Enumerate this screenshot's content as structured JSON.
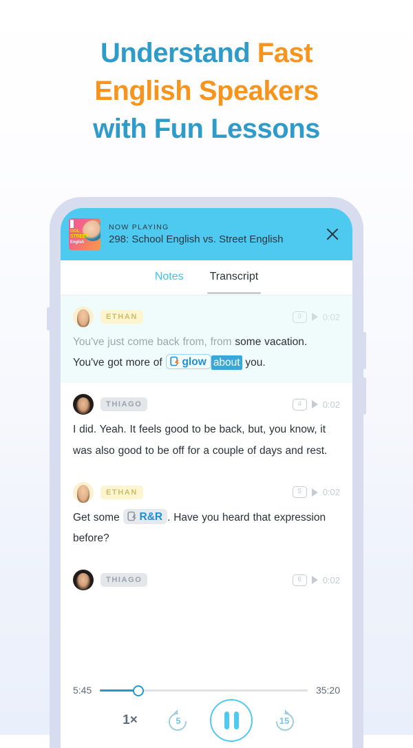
{
  "headline": {
    "line1_a": "Understand ",
    "line1_b": "Fast",
    "line2": "English Speakers",
    "line3": "with Fun Lessons",
    "color_blue": "#2e9bc9",
    "color_orange": "#f7941e"
  },
  "player_header": {
    "now_playing_label": "NOW PLAYING",
    "episode_title": "298: School English vs. Street English",
    "close_icon": "close-icon",
    "album_art": {
      "text_line1": "OOL",
      "text_line2": "STREET",
      "text_line3": "English"
    },
    "bg_color": "#4ec9f0"
  },
  "tabs": [
    {
      "label": "Notes",
      "selected_color": true,
      "underlined": false
    },
    {
      "label": "Transcript",
      "selected_color": false,
      "underlined": true
    }
  ],
  "transcript": {
    "messages": [
      {
        "speaker": "ETHAN",
        "speaker_style": "ethan",
        "index_badge": "3",
        "timestamp": "0:02",
        "playing": true,
        "text_spoken": "You've just come back from, from ",
        "text_plain_1": " some vacation. You've got more of ",
        "chip_label": "glow",
        "chip_style": "bordered",
        "highlight_word": "about",
        "text_plain_2": " you."
      },
      {
        "speaker": "THIAGO",
        "speaker_style": "thiago",
        "index_badge": "4",
        "timestamp": "0:02",
        "playing": false,
        "text_full": "I did. Yeah. It feels good to be back, but, you know, it was also good to be off for a couple of days and rest."
      },
      {
        "speaker": "ETHAN",
        "speaker_style": "ethan",
        "index_badge": "5",
        "timestamp": "0:02",
        "playing": false,
        "text_plain_1": "Get some ",
        "chip_label": "R&R",
        "chip_style": "plain",
        "text_plain_2": ". Have you heard that expression before?"
      },
      {
        "speaker": "THIAGO",
        "speaker_style": "thiago",
        "index_badge": "6",
        "timestamp": "0:02",
        "playing": false,
        "text_full": ""
      }
    ]
  },
  "bottom_player": {
    "current_time": "5:45",
    "total_time": "35:20",
    "progress_percent": 18,
    "speed_label": "1×",
    "rewind_label": "5",
    "forward_label": "15",
    "pause_icon": "pause-icon",
    "accent_color": "#4ec9f0"
  }
}
